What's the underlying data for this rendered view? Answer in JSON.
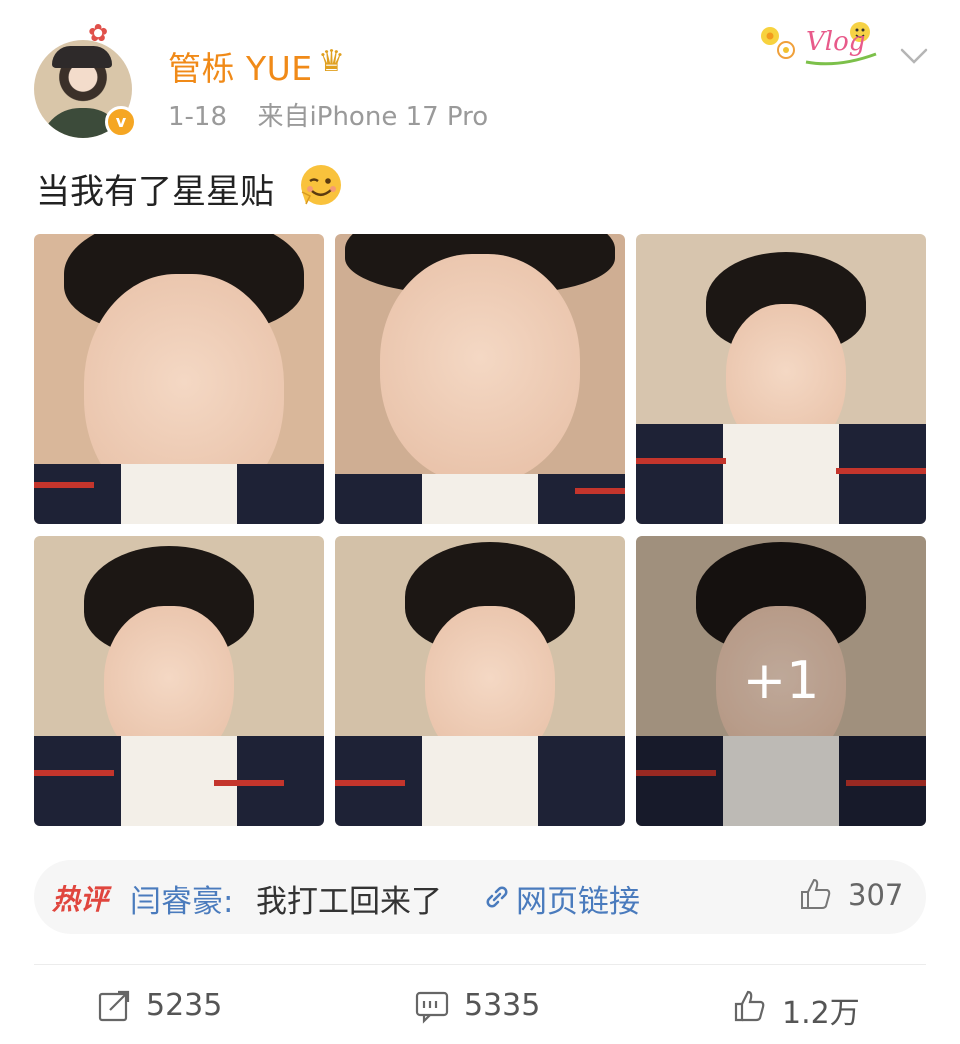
{
  "author": {
    "name": "管栎 YUE",
    "verified_badge": "v",
    "avatar_icon": "avatar",
    "crown_icon": "crown-icon",
    "sticker_icon": "camera-sticker-icon"
  },
  "post": {
    "date": "1-18",
    "source": "来自iPhone 17 Pro",
    "text": "当我有了星星贴",
    "emoji_icon": "wink-emoji-icon",
    "decoration": "Vlog",
    "images": [
      {
        "name": "photo-1"
      },
      {
        "name": "photo-2"
      },
      {
        "name": "photo-3"
      },
      {
        "name": "photo-4"
      },
      {
        "name": "photo-5"
      },
      {
        "name": "photo-6"
      }
    ],
    "more_images_label": "+1"
  },
  "hot_comment": {
    "tag": "热评",
    "user": "闫睿豪:",
    "text": "我打工回来了",
    "link_label": "网页链接",
    "likes": "307"
  },
  "actions": {
    "repost_count": "5235",
    "comment_count": "5335",
    "like_count": "1.2万"
  },
  "colors": {
    "username": "#f08a18",
    "link": "#4a7bbd",
    "hot_tag": "#e0463e",
    "meta": "#9a9a9a"
  }
}
